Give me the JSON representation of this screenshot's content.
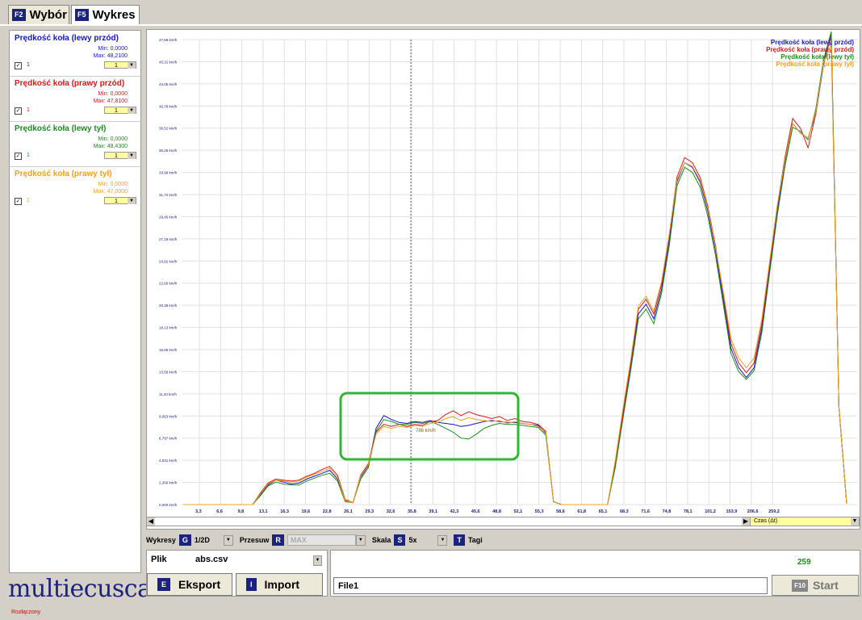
{
  "tabs": [
    {
      "key": "F2",
      "label": "Wybór",
      "active": false
    },
    {
      "key": "F5",
      "label": "Wykres",
      "active": true
    }
  ],
  "channels": [
    {
      "name": "Prędkość koła (lewy przód)",
      "min": "Min: 0,0000",
      "max": "Max: 48,2100",
      "num": "1",
      "scale": "1",
      "color": "#1515c8",
      "checked": "✓"
    },
    {
      "name": "Prędkość koła (prawy przód)",
      "min": "Min: 0,0000",
      "max": "Max: 47,8100",
      "num": "1",
      "scale": "1",
      "color": "#d81818",
      "checked": "✓"
    },
    {
      "name": "Prędkość koła (lewy tył)",
      "min": "Min: 0,0000",
      "max": "Max: 48,4300",
      "num": "1",
      "scale": "1",
      "color": "#1e8b1e",
      "checked": "✓"
    },
    {
      "name": "Prędkość koła (prawy tył)",
      "min": "Min: 0,0000",
      "max": "Max: 47,0000",
      "num": "1",
      "scale": "1",
      "color": "#f0a020",
      "checked": "✓"
    }
  ],
  "logo": "multiecuscan",
  "chart_data": {
    "type": "line",
    "y_ticks": [
      "47,58 km/h",
      "45,31 km/h",
      "43,05 km/h",
      "40,78 km/h",
      "38,52 km/h",
      "36,25 km/h",
      "33,99 km/h",
      "31,72 km/h",
      "29,45 km/h",
      "27,19 km/h",
      "24,92 km/h",
      "22,66 km/h",
      "20,39 km/h",
      "18,13 km/h",
      "15,86 km/h",
      "13,59 km/h",
      "11,33 km/h",
      "9,063 km/h",
      "6,797 km/h",
      "4,531 km/h",
      "2,266 km/h",
      "0,000 km/h"
    ],
    "ylim": [
      0,
      47.58
    ],
    "x_ticks": [
      "3,3",
      "6,6",
      "9,8",
      "13,1",
      "16,3",
      "19,6",
      "22,8",
      "26,1",
      "29,3",
      "32,6",
      "35,8",
      "39,1",
      "42,3",
      "45,6",
      "48,8",
      "52,1",
      "55,3",
      "58,6",
      "61,8",
      "65,1",
      "68,3",
      "71,6",
      "74,8",
      "78,1",
      "101,2",
      "153,9",
      "206,6",
      "259,2"
    ],
    "x_axis_label": "Czas (Δt)",
    "cursor_label": "786 km/h",
    "series": [
      {
        "name": "Prędkość koła (lewy przód)",
        "color": "#1515c8",
        "values": [
          0,
          0,
          0,
          0,
          0,
          0,
          0,
          0,
          0,
          0,
          1,
          2,
          2.5,
          2.3,
          2.1,
          2.2,
          2.6,
          2.9,
          3.2,
          3.5,
          2.6,
          0.4,
          0.2,
          2.8,
          4,
          7.8,
          9.1,
          8.7,
          8.4,
          8.3,
          8.5,
          8.4,
          8.6,
          8.4,
          8.3,
          8.2,
          8,
          8.1,
          8.3,
          8.5,
          8.6,
          8.5,
          8.4,
          8.4,
          8.3,
          8.2,
          8.1,
          7.3,
          0.3,
          0,
          0,
          0,
          0,
          0,
          0,
          0,
          4,
          9,
          14,
          19.5,
          20.5,
          19,
          22,
          27,
          33,
          35,
          34.5,
          33,
          30,
          26,
          21,
          16,
          14,
          13,
          14,
          18,
          24,
          30,
          35,
          39,
          38,
          37.5,
          40,
          45,
          48.2,
          10,
          0.1
        ]
      },
      {
        "name": "Prędkość koła (prawy przód)",
        "color": "#d81818",
        "values": [
          0,
          0,
          0,
          0,
          0,
          0,
          0,
          0,
          0,
          0,
          1.2,
          2.2,
          2.6,
          2.5,
          2.4,
          2.5,
          2.9,
          3.2,
          3.6,
          3.9,
          3,
          0.5,
          0.2,
          3,
          4.2,
          7.4,
          8.2,
          8,
          8.2,
          8,
          8.2,
          8.1,
          8.5,
          8.6,
          9.2,
          9.6,
          9.1,
          9.5,
          9.2,
          9,
          8.8,
          9,
          8.6,
          8.8,
          8.5,
          8.4,
          8.2,
          7.5,
          0.3,
          0,
          0,
          0,
          0,
          0,
          0,
          0,
          4.2,
          9.4,
          14.5,
          20,
          21,
          19.5,
          22.5,
          27.5,
          33.5,
          35.5,
          35,
          33.5,
          30.5,
          26.5,
          21.5,
          16.5,
          14.5,
          13.5,
          14.5,
          18.5,
          24.5,
          30.5,
          35.5,
          39.5,
          38.5,
          36.5,
          40,
          45.5,
          47.8,
          10,
          0.1
        ]
      },
      {
        "name": "Prędkość koła (lewy tył)",
        "color": "#1e8b1e",
        "values": [
          0,
          0,
          0,
          0,
          0,
          0,
          0,
          0,
          0,
          0,
          0.9,
          1.9,
          2.3,
          2.1,
          2,
          2,
          2.4,
          2.7,
          3,
          3.2,
          2.4,
          0.3,
          0.2,
          2.6,
          3.8,
          7.5,
          8.7,
          8.5,
          8.2,
          8.2,
          8.4,
          8.3,
          8.5,
          8.2,
          7.8,
          7.4,
          6.8,
          6.7,
          7.2,
          7.8,
          8.1,
          8.3,
          8.2,
          8.2,
          8.1,
          8,
          7.9,
          7.1,
          0.3,
          0,
          0,
          0,
          0,
          0,
          0,
          0,
          3.8,
          8.8,
          13.7,
          19,
          20,
          18.5,
          21.6,
          26.5,
          32.6,
          34.5,
          34,
          32.5,
          29.5,
          25.5,
          20.5,
          15.5,
          13.6,
          12.8,
          13.7,
          17.6,
          23.6,
          29.6,
          34.6,
          38.6,
          38.2,
          37.3,
          40.5,
          45.5,
          48.4,
          10,
          0.1
        ]
      },
      {
        "name": "Prędkość koła (prawy tył)",
        "color": "#f0a020",
        "values": [
          0,
          0,
          0,
          0,
          0,
          0,
          0,
          0,
          0,
          0,
          1.1,
          2.1,
          2.5,
          2.4,
          2.3,
          2.4,
          2.8,
          3.1,
          3.4,
          3.7,
          2.8,
          0.4,
          0.2,
          2.9,
          4.1,
          7.2,
          8,
          7.8,
          8,
          7.9,
          8.1,
          8,
          8.3,
          8.4,
          8.8,
          9,
          8.6,
          8.9,
          8.7,
          8.6,
          8.5,
          8.6,
          8.3,
          8.5,
          8.3,
          8.2,
          8,
          7.4,
          0.3,
          0,
          0,
          0,
          0,
          0,
          0,
          0,
          4.5,
          9.8,
          14.8,
          20.3,
          21.3,
          19.8,
          22.8,
          27.7,
          33.2,
          35,
          34.6,
          33.2,
          30.3,
          26.3,
          21.8,
          17,
          15,
          14,
          15,
          19,
          24.8,
          30.6,
          35.2,
          39,
          38,
          37.5,
          40.2,
          45.2,
          47,
          10,
          0.1
        ]
      }
    ]
  },
  "toolbar": {
    "wykresy_label": "Wykresy",
    "wykresy_key": "G",
    "wykresy_value": "1/2D",
    "przesuw_label": "Przesuw",
    "przesuw_key": "R",
    "przesuw_value": "MAX",
    "skala_label": "Skala",
    "skala_key": "S",
    "skala_value": "5x",
    "tagi_key": "T",
    "tagi_label": "Tagi"
  },
  "file": {
    "label": "Plik",
    "name": "abs.csv"
  },
  "export_button": {
    "key": "E",
    "label": "Eksport"
  },
  "import_button": {
    "key": "I",
    "label": "Import"
  },
  "status": {
    "count": "259",
    "comment": "File1",
    "start_key": "F10",
    "start_label": "Start"
  },
  "status_bar": "Rozłączony"
}
